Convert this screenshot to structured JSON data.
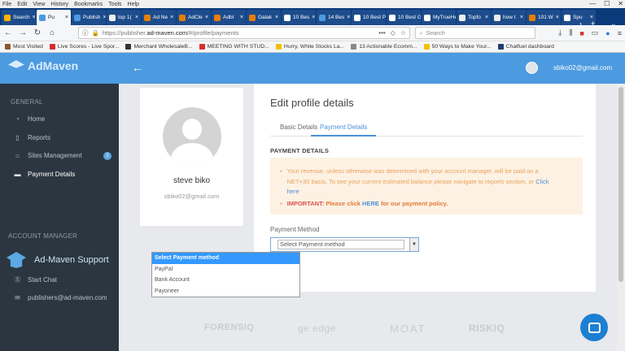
{
  "browser": {
    "menu": [
      "File",
      "Edit",
      "View",
      "History",
      "Bookmarks",
      "Tools",
      "Help"
    ],
    "tabs": [
      {
        "label": "Search",
        "fav": "#ffb300",
        "active": false
      },
      {
        "label": "Pu",
        "fav": "#4c9ae0",
        "active": true
      },
      {
        "label": "Publish",
        "fav": "#4c9ae0",
        "active": false
      },
      {
        "label": "top 1(",
        "fav": "#eeeeee",
        "active": false
      },
      {
        "label": "Ad Ne",
        "fav": "#e87e04",
        "active": false
      },
      {
        "label": "AdCle",
        "fav": "#e87e04",
        "active": false
      },
      {
        "label": "Adbl",
        "fav": "#e87e04",
        "active": false
      },
      {
        "label": "Galak",
        "fav": "#e87e04",
        "active": false
      },
      {
        "label": "10 Bes",
        "fav": "#ffffff",
        "active": false
      },
      {
        "label": "14 Bes",
        "fav": "#4c9ae0",
        "active": false
      },
      {
        "label": "10 Best Pa",
        "fav": "#ffffff",
        "active": false
      },
      {
        "label": "10 Best Gc",
        "fav": "#ffffff",
        "active": false
      },
      {
        "label": "MyTrueHe",
        "fav": "#ffffff",
        "active": false
      },
      {
        "label": "Topfo",
        "fav": "#eeeeee",
        "active": false
      },
      {
        "label": "how t",
        "fav": "#eeeeee",
        "active": false
      },
      {
        "label": "101 W",
        "fav": "#e87e04",
        "active": false
      },
      {
        "label": "Spo",
        "fav": "#ffffff",
        "active": false
      }
    ],
    "url_host": "https://publisher.",
    "url_domain": "ad-maven.com",
    "url_path": "/#/profile/payments",
    "search_placeholder": "Search",
    "bookmarks": [
      {
        "label": "Most Visited",
        "color": "#8a5a2b"
      },
      {
        "label": "Live Scores - Live Spor...",
        "color": "#d32f2f"
      },
      {
        "label": "Merchant WholesaleB...",
        "color": "#333333"
      },
      {
        "label": "MEETING WITH STUD...",
        "color": "#d32f2f"
      },
      {
        "label": "Hurry, While Stocks La...",
        "color": "#f2c200"
      },
      {
        "label": "13 Actionable Ecomm...",
        "color": "#888888"
      },
      {
        "label": "50 Ways to Make Your...",
        "color": "#f2c200"
      },
      {
        "label": "Chatfuel dashboard",
        "color": "#1d3c6d"
      }
    ]
  },
  "app": {
    "logo": "AdMaven",
    "user_email": "sbiko02@gmail.com",
    "sidebar": {
      "general_header": "GENERAL",
      "items": [
        {
          "label": "Home",
          "icon": "dashboard-icon"
        },
        {
          "label": "Reports",
          "icon": "reports-icon"
        },
        {
          "label": "Sites Management",
          "icon": "sites-icon",
          "badge": "1"
        },
        {
          "label": "Payment Details",
          "icon": "card-icon",
          "active": true
        }
      ],
      "account_header": "ACCOUNT MANAGER",
      "support_title": "Ad-Maven Support",
      "start_chat": "Start Chat",
      "support_email": "publishers@ad-maven.com"
    },
    "profile": {
      "name": "steve biko",
      "email": "sbiko02@gmail.com"
    },
    "edit": {
      "title": "Edit profile details",
      "tabs": [
        "Basic Details",
        "Payment Details"
      ],
      "section": "PAYMENT DETAILS",
      "notice_line1": "Your revenue, unless otherwise was determined with your account manager, will be paid on a",
      "notice_line2_a": "NET+30 basis. To see your current estimated balance please navigate to reports section, or ",
      "notice_line2_link": "Click",
      "notice_line3": "here",
      "important_prefix": "IMPORTANT: ",
      "important_text": "Please click ",
      "important_link": "HERE",
      "important_suffix": " for our payment policy.",
      "payment_label": "Payment Method",
      "select_value": "Select Payment method",
      "options": [
        "Select Payment method",
        "PayPal",
        "Bank Account",
        "Payoneer"
      ]
    },
    "partners": [
      "FORENSIQ",
      "ge edge",
      "MOAT",
      "RISKIQ"
    ]
  }
}
